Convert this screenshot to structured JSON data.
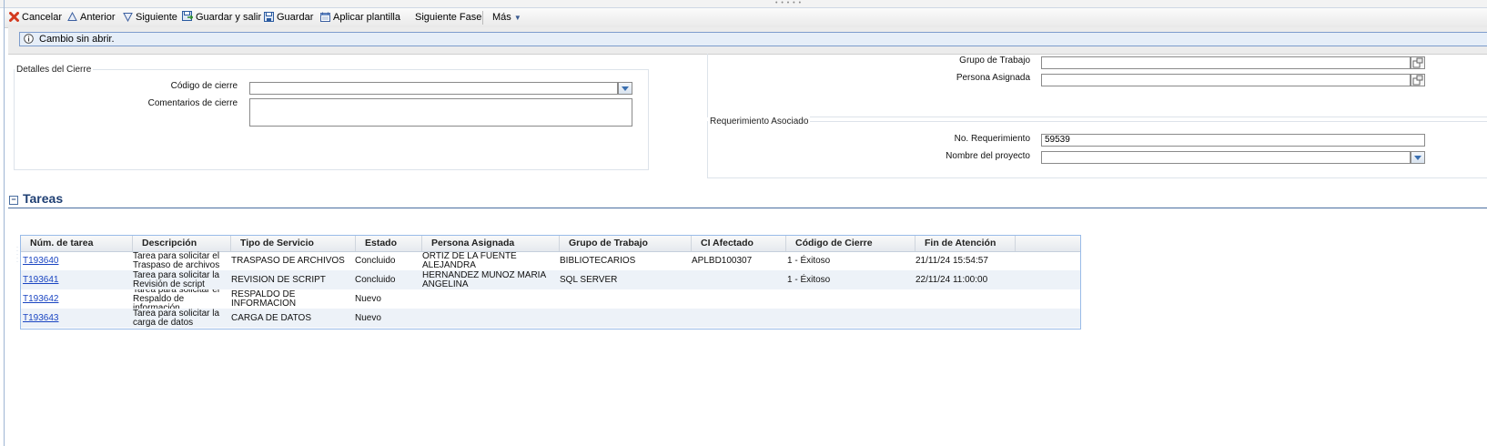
{
  "toolbar": {
    "cancel": "Cancelar",
    "previous": "Anterior",
    "next": "Siguiente",
    "save_exit": "Guardar y salir",
    "save": "Guardar",
    "apply_template": "Aplicar plantilla",
    "next_phase": "Siguiente Fase",
    "more": "Más"
  },
  "info_message": "Cambio sin abrir.",
  "closure": {
    "legend": "Detalles del Cierre",
    "code_label": "Código de cierre",
    "code_value": "",
    "comments_label": "Comentarios de cierre",
    "comments_value": ""
  },
  "assignment": {
    "group_label": "Grupo de Trabajo",
    "group_value": "",
    "person_label": "Persona Asignada",
    "person_value": ""
  },
  "requirement": {
    "legend": "Requerimiento Asociado",
    "number_label": "No. Requerimiento",
    "number_value": "59539",
    "project_label": "Nombre del proyecto",
    "project_value": ""
  },
  "tasks": {
    "title": "Tareas",
    "columns": [
      "Núm. de tarea",
      "Descripción",
      "Tipo de Servicio",
      "Estado",
      "Persona Asignada",
      "Grupo de Trabajo",
      "CI Afectado",
      "Código de Cierre",
      "Fin de Atención"
    ],
    "rows": [
      {
        "id": "T193640",
        "desc": "Tarea para solicitar el Traspaso de archivos",
        "service": "TRASPASO DE ARCHIVOS",
        "status": "Concluido",
        "person": "ORTIZ DE LA FUENTE ALEJANDRA",
        "group": "BIBLIOTECARIOS",
        "ci": "APLBD100307",
        "closure": "1 - Éxitoso",
        "end": "21/11/24 15:54:57"
      },
      {
        "id": "T193641",
        "desc": "Tarea para solicitar la Revisión de script",
        "service": "REVISION DE SCRIPT",
        "status": "Concluido",
        "person": "HERNANDEZ MUÑOZ MARIA ANGELINA",
        "group": "SQL SERVER",
        "ci": "",
        "closure": "1 - Éxitoso",
        "end": "22/11/24 11:00:00"
      },
      {
        "id": "T193642",
        "desc": "Tarea para solicitar el Respaldo de información",
        "service": "RESPALDO DE INFORMACION",
        "status": "Nuevo",
        "person": "",
        "group": "",
        "ci": "",
        "closure": "",
        "end": ""
      },
      {
        "id": "T193643",
        "desc": "Tarea para solicitar la carga de datos",
        "service": "CARGA DE DATOS",
        "status": "Nuevo",
        "person": "",
        "group": "",
        "ci": "",
        "closure": "",
        "end": ""
      }
    ]
  },
  "colors": {
    "accent": "#1f3f73",
    "link": "#1a45c2",
    "grid_border": "#99bbe8",
    "info_border": "#7d9ccc"
  },
  "icons": [
    "cancel-icon",
    "previous-icon",
    "next-icon",
    "save-exit-icon",
    "save-icon",
    "template-icon",
    "more-chevron-icon",
    "info-icon",
    "dropdown-arrow-icon",
    "picker-icon",
    "collapse-icon"
  ]
}
